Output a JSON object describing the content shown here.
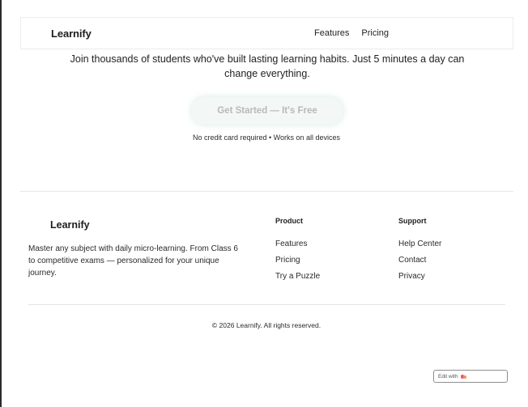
{
  "header": {
    "brand": "Learnify",
    "nav": [
      {
        "label": "Features"
      },
      {
        "label": "Pricing"
      }
    ]
  },
  "hero": {
    "tagline": "Join thousands of students who've built lasting learning habits. Just 5 minutes a day can change everything.",
    "cta_label": "Get Started — It's Free",
    "cta_note": "No credit card required • Works on all devices"
  },
  "footer": {
    "brand": "Learnify",
    "description": "Master any subject with daily micro-learning. From Class 6 to competitive exams — personalized for your unique journey.",
    "product": {
      "heading": "Product",
      "links": [
        {
          "label": "Features"
        },
        {
          "label": "Pricing"
        },
        {
          "label": "Try a Puzzle"
        }
      ]
    },
    "support": {
      "heading": "Support",
      "links": [
        {
          "label": "Help Center"
        },
        {
          "label": "Contact"
        },
        {
          "label": "Privacy"
        }
      ]
    },
    "copyright": "© 2026 Learnify. All rights reserved."
  },
  "badge": {
    "label": "Edit with",
    "icon": "lovable-logo-icon"
  },
  "colors": {
    "accent_glow": "#78c8be",
    "text": "#222222",
    "border": "#ececec"
  }
}
